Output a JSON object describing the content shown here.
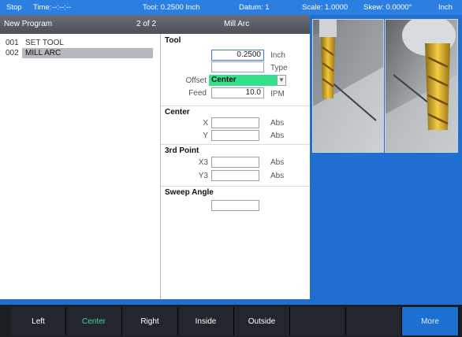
{
  "status": {
    "mode": "Stop",
    "time_label": "Time:",
    "time_value": "--:--:--",
    "tool": "Tool: 0.2500 Inch",
    "datum": "Datum: 1",
    "scale": "Scale: 1.0000",
    "skew": "Skew: 0.0000°",
    "units": "Inch"
  },
  "titlebar": {
    "program": "New Program",
    "step": "2 of 2",
    "operation": "Mill Arc"
  },
  "program_steps": [
    {
      "num": "001",
      "label": "SET TOOL",
      "selected": false
    },
    {
      "num": "002",
      "label": "MILL ARC",
      "selected": true
    }
  ],
  "form": {
    "tool": {
      "title": "Tool",
      "diameter": "0.2500",
      "diameter_unit": "Inch",
      "type_value": "",
      "type_label": "Type",
      "offset_label": "Offset",
      "offset_value": "Center",
      "feed_label": "Feed",
      "feed_value": "10.0",
      "feed_unit": "IPM"
    },
    "center": {
      "title": "Center",
      "x_label": "X",
      "x_value": "",
      "x_unit": "Abs",
      "y_label": "Y",
      "y_value": "",
      "y_unit": "Abs"
    },
    "third_point": {
      "title": "3rd Point",
      "x3_label": "X3",
      "x3_value": "",
      "x3_unit": "Abs",
      "y3_label": "Y3",
      "y3_value": "",
      "y3_unit": "Abs"
    },
    "sweep": {
      "title": "Sweep Angle",
      "value": ""
    }
  },
  "softkeys": [
    {
      "label": "Left",
      "active": false
    },
    {
      "label": "Center",
      "active": true
    },
    {
      "label": "Right",
      "active": false
    },
    {
      "label": "Inside",
      "active": false
    },
    {
      "label": "Outside",
      "active": false
    },
    {
      "label": "",
      "active": false
    },
    {
      "label": "",
      "active": false
    },
    {
      "label": "More",
      "active": false
    }
  ],
  "colors": {
    "background_blue": "#1e6fd0",
    "status_bar": "#2a7fe0",
    "selected_offset": "#34e08c",
    "active_softkey_text": "#3fd6a0"
  }
}
